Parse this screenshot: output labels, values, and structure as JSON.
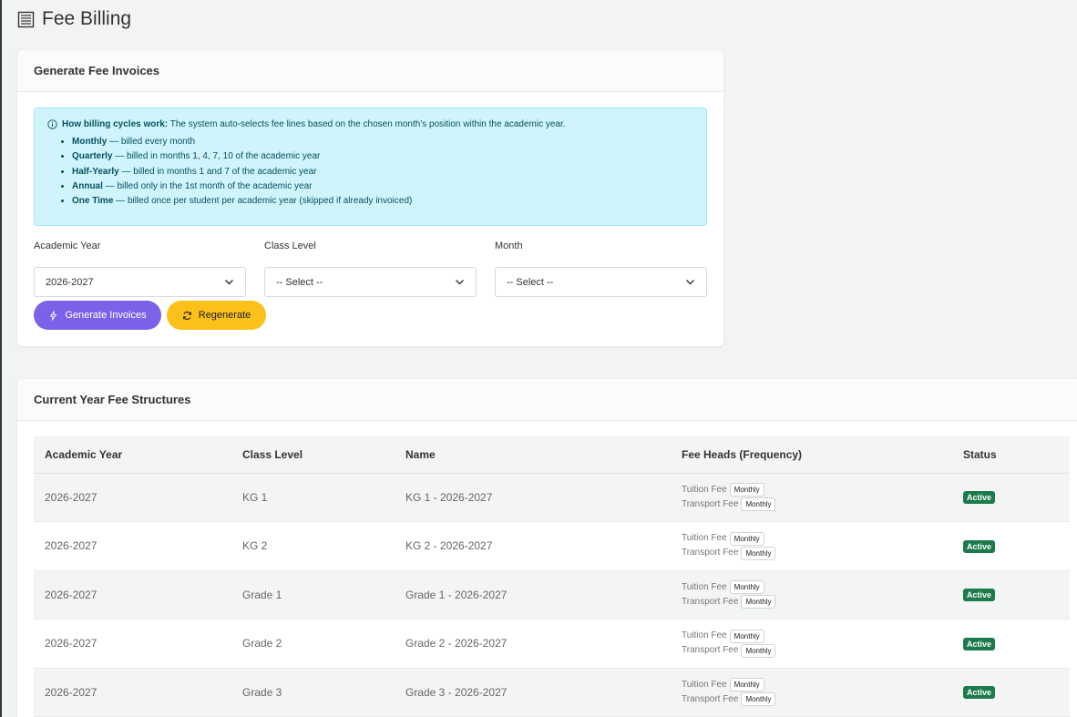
{
  "page": {
    "title": "Fee Billing",
    "icon": "receipt-icon"
  },
  "generate_card": {
    "title": "Generate Fee Invoices",
    "info": {
      "lead_bold": "How billing cycles work:",
      "lead_text": " The system auto-selects fee lines based on the chosen month's position within the academic year.",
      "items": [
        {
          "bold": "Monthly",
          "text": " — billed every month"
        },
        {
          "bold": "Quarterly",
          "text": " — billed in months 1, 4, 7, 10 of the academic year"
        },
        {
          "bold": "Half-Yearly",
          "text": " — billed in months 1 and 7 of the academic year"
        },
        {
          "bold": "Annual",
          "text": " — billed only in the 1st month of the academic year"
        },
        {
          "bold": "One Time",
          "text": " — billed once per student per academic year (skipped if already invoiced)"
        }
      ]
    },
    "form": {
      "academic_year": {
        "label": "Academic Year",
        "value": "2026-2027"
      },
      "class_level": {
        "label": "Class Level",
        "value": "-- Select --"
      },
      "month": {
        "label": "Month",
        "value": "-- Select --"
      }
    },
    "buttons": {
      "generate": "Generate Invoices",
      "regenerate": "Regenerate"
    }
  },
  "structures_card": {
    "title": "Current Year Fee Structures",
    "columns": [
      "Academic Year",
      "Class Level",
      "Name",
      "Fee Heads (Frequency)",
      "Status"
    ],
    "rows": [
      {
        "year": "2026-2027",
        "class": "KG 1",
        "name": "KG 1 - 2026-2027",
        "fees": [
          {
            "head": "Tuition Fee",
            "freq": "Monthly"
          },
          {
            "head": "Transport Fee",
            "freq": "Monthly"
          }
        ],
        "status": "Active"
      },
      {
        "year": "2026-2027",
        "class": "KG 2",
        "name": "KG 2 - 2026-2027",
        "fees": [
          {
            "head": "Tuition Fee",
            "freq": "Monthly"
          },
          {
            "head": "Transport Fee",
            "freq": "Monthly"
          }
        ],
        "status": "Active"
      },
      {
        "year": "2026-2027",
        "class": "Grade 1",
        "name": "Grade 1 - 2026-2027",
        "fees": [
          {
            "head": "Tuition Fee",
            "freq": "Monthly"
          },
          {
            "head": "Transport Fee",
            "freq": "Monthly"
          }
        ],
        "status": "Active"
      },
      {
        "year": "2026-2027",
        "class": "Grade 2",
        "name": "Grade 2 - 2026-2027",
        "fees": [
          {
            "head": "Tuition Fee",
            "freq": "Monthly"
          },
          {
            "head": "Transport Fee",
            "freq": "Monthly"
          }
        ],
        "status": "Active"
      },
      {
        "year": "2026-2027",
        "class": "Grade 3",
        "name": "Grade 3 - 2026-2027",
        "fees": [
          {
            "head": "Tuition Fee",
            "freq": "Monthly"
          },
          {
            "head": "Transport Fee",
            "freq": "Monthly"
          }
        ],
        "status": "Active"
      }
    ]
  },
  "colors": {
    "primary_button": "#7c62e8",
    "warning_button": "#fbc11a",
    "info_background": "#cff4fc",
    "info_text": "#055160",
    "status_active": "#1c7a4b"
  }
}
